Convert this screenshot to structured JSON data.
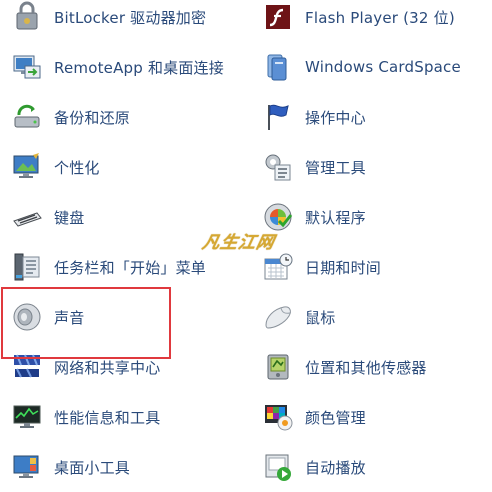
{
  "left_items": [
    {
      "label": "BitLocker 驱动器加密",
      "icon": "bitlocker-icon"
    },
    {
      "label": "RemoteApp 和桌面连接",
      "icon": "remoteapp-icon"
    },
    {
      "label": "备份和还原",
      "icon": "backup-restore-icon"
    },
    {
      "label": "个性化",
      "icon": "personalization-icon"
    },
    {
      "label": "键盘",
      "icon": "keyboard-icon"
    },
    {
      "label": "任务栏和「开始」菜单",
      "icon": "taskbar-start-menu-icon"
    },
    {
      "label": "声音",
      "icon": "speaker-icon"
    },
    {
      "label": "网络和共享中心",
      "icon": "network-sharing-icon"
    },
    {
      "label": "性能信息和工具",
      "icon": "performance-icon"
    },
    {
      "label": "桌面小工具",
      "icon": "desktop-gadgets-icon"
    }
  ],
  "right_items": [
    {
      "label": "Flash Player (32 位)",
      "icon": "flash-player-icon"
    },
    {
      "label": "Windows CardSpace",
      "icon": "cardspace-icon"
    },
    {
      "label": "操作中心",
      "icon": "action-center-flag-icon"
    },
    {
      "label": "管理工具",
      "icon": "admin-tools-icon"
    },
    {
      "label": "默认程序",
      "icon": "default-programs-icon"
    },
    {
      "label": "日期和时间",
      "icon": "calendar-clock-icon"
    },
    {
      "label": "鼠标",
      "icon": "mouse-icon"
    },
    {
      "label": "位置和其他传感器",
      "icon": "location-sensors-icon"
    },
    {
      "label": "颜色管理",
      "icon": "color-management-icon"
    },
    {
      "label": "自动播放",
      "icon": "autoplay-icon"
    }
  ],
  "watermark": "凡生江网",
  "colors": {
    "link_text": "#2a4a7a",
    "highlight_border": "#e0393e",
    "watermark": "#d4a428"
  }
}
